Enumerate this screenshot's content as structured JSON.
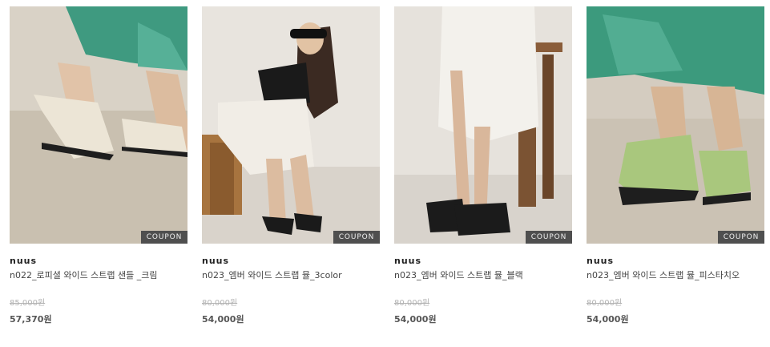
{
  "products": [
    {
      "coupon": "COUPON",
      "brand": "nuus",
      "name": "n022_로피셜 와이드 스트랩 샌들 _크림",
      "original_price": "85,000원",
      "sale_price": "57,370원"
    },
    {
      "coupon": "COUPON",
      "brand": "nuus",
      "name": "n023_엠버 와이드 스트랩 뮬_3color",
      "original_price": "80,000원",
      "sale_price": "54,000원"
    },
    {
      "coupon": "COUPON",
      "brand": "nuus",
      "name": "n023_엠버 와이드 스트랩 뮬_블랙",
      "original_price": "80,000원",
      "sale_price": "54,000원"
    },
    {
      "coupon": "COUPON",
      "brand": "nuus",
      "name": "n023_엠버 와이드 스트랩 뮬_피스타치오",
      "original_price": "80,000원",
      "sale_price": "54,000원"
    }
  ]
}
